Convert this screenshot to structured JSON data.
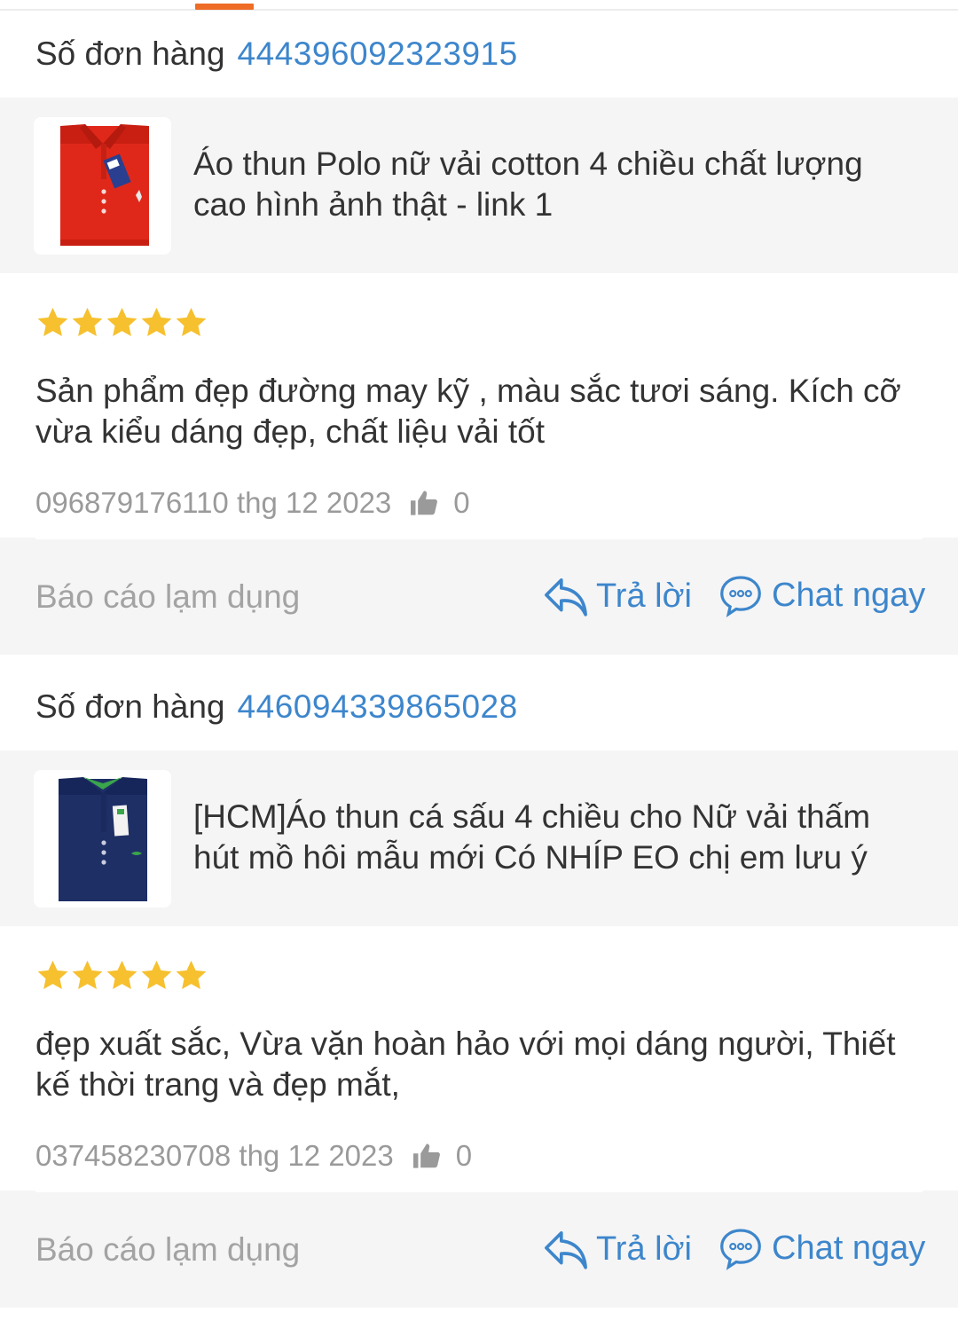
{
  "colors": {
    "accent": "#ee6c26",
    "link": "#3d86cc",
    "star": "#f6c02e",
    "muted": "#9a9a9a"
  },
  "reviews": [
    {
      "order_label": "Số đơn hàng",
      "order_number": "444396092323915",
      "product_title": "Áo thun Polo nữ vải cotton 4 chiều chất lượng cao hình ảnh thật - link 1",
      "product_image": "red-polo-shirt",
      "rating": 5,
      "review_text": "Sản phẩm đẹp đường may kỹ , màu sắc tươi sáng. Kích cỡ vừa kiểu dáng đẹp, chất liệu vải tốt",
      "reviewer_date": "096879176110 thg 12 2023",
      "like_count": "0",
      "report_label": "Báo cáo lạm dụng",
      "reply_label": "Trả lời",
      "chat_label": "Chat ngay"
    },
    {
      "order_label": "Số đơn hàng",
      "order_number": "446094339865028",
      "product_title": "[HCM]Áo thun cá sấu 4 chiều cho Nữ vải thấm hút mồ hôi mẫu mới Có NHÍP EO chị em lưu ý",
      "product_image": "navy-polo-shirt",
      "rating": 5,
      "review_text": "đẹp xuất sắc, Vừa vặn hoàn hảo với mọi dáng người, Thiết kế thời trang và đẹp mắt,",
      "reviewer_date": "037458230708 thg 12 2023",
      "like_count": "0",
      "report_label": "Báo cáo lạm dụng",
      "reply_label": "Trả lời",
      "chat_label": "Chat ngay"
    }
  ]
}
